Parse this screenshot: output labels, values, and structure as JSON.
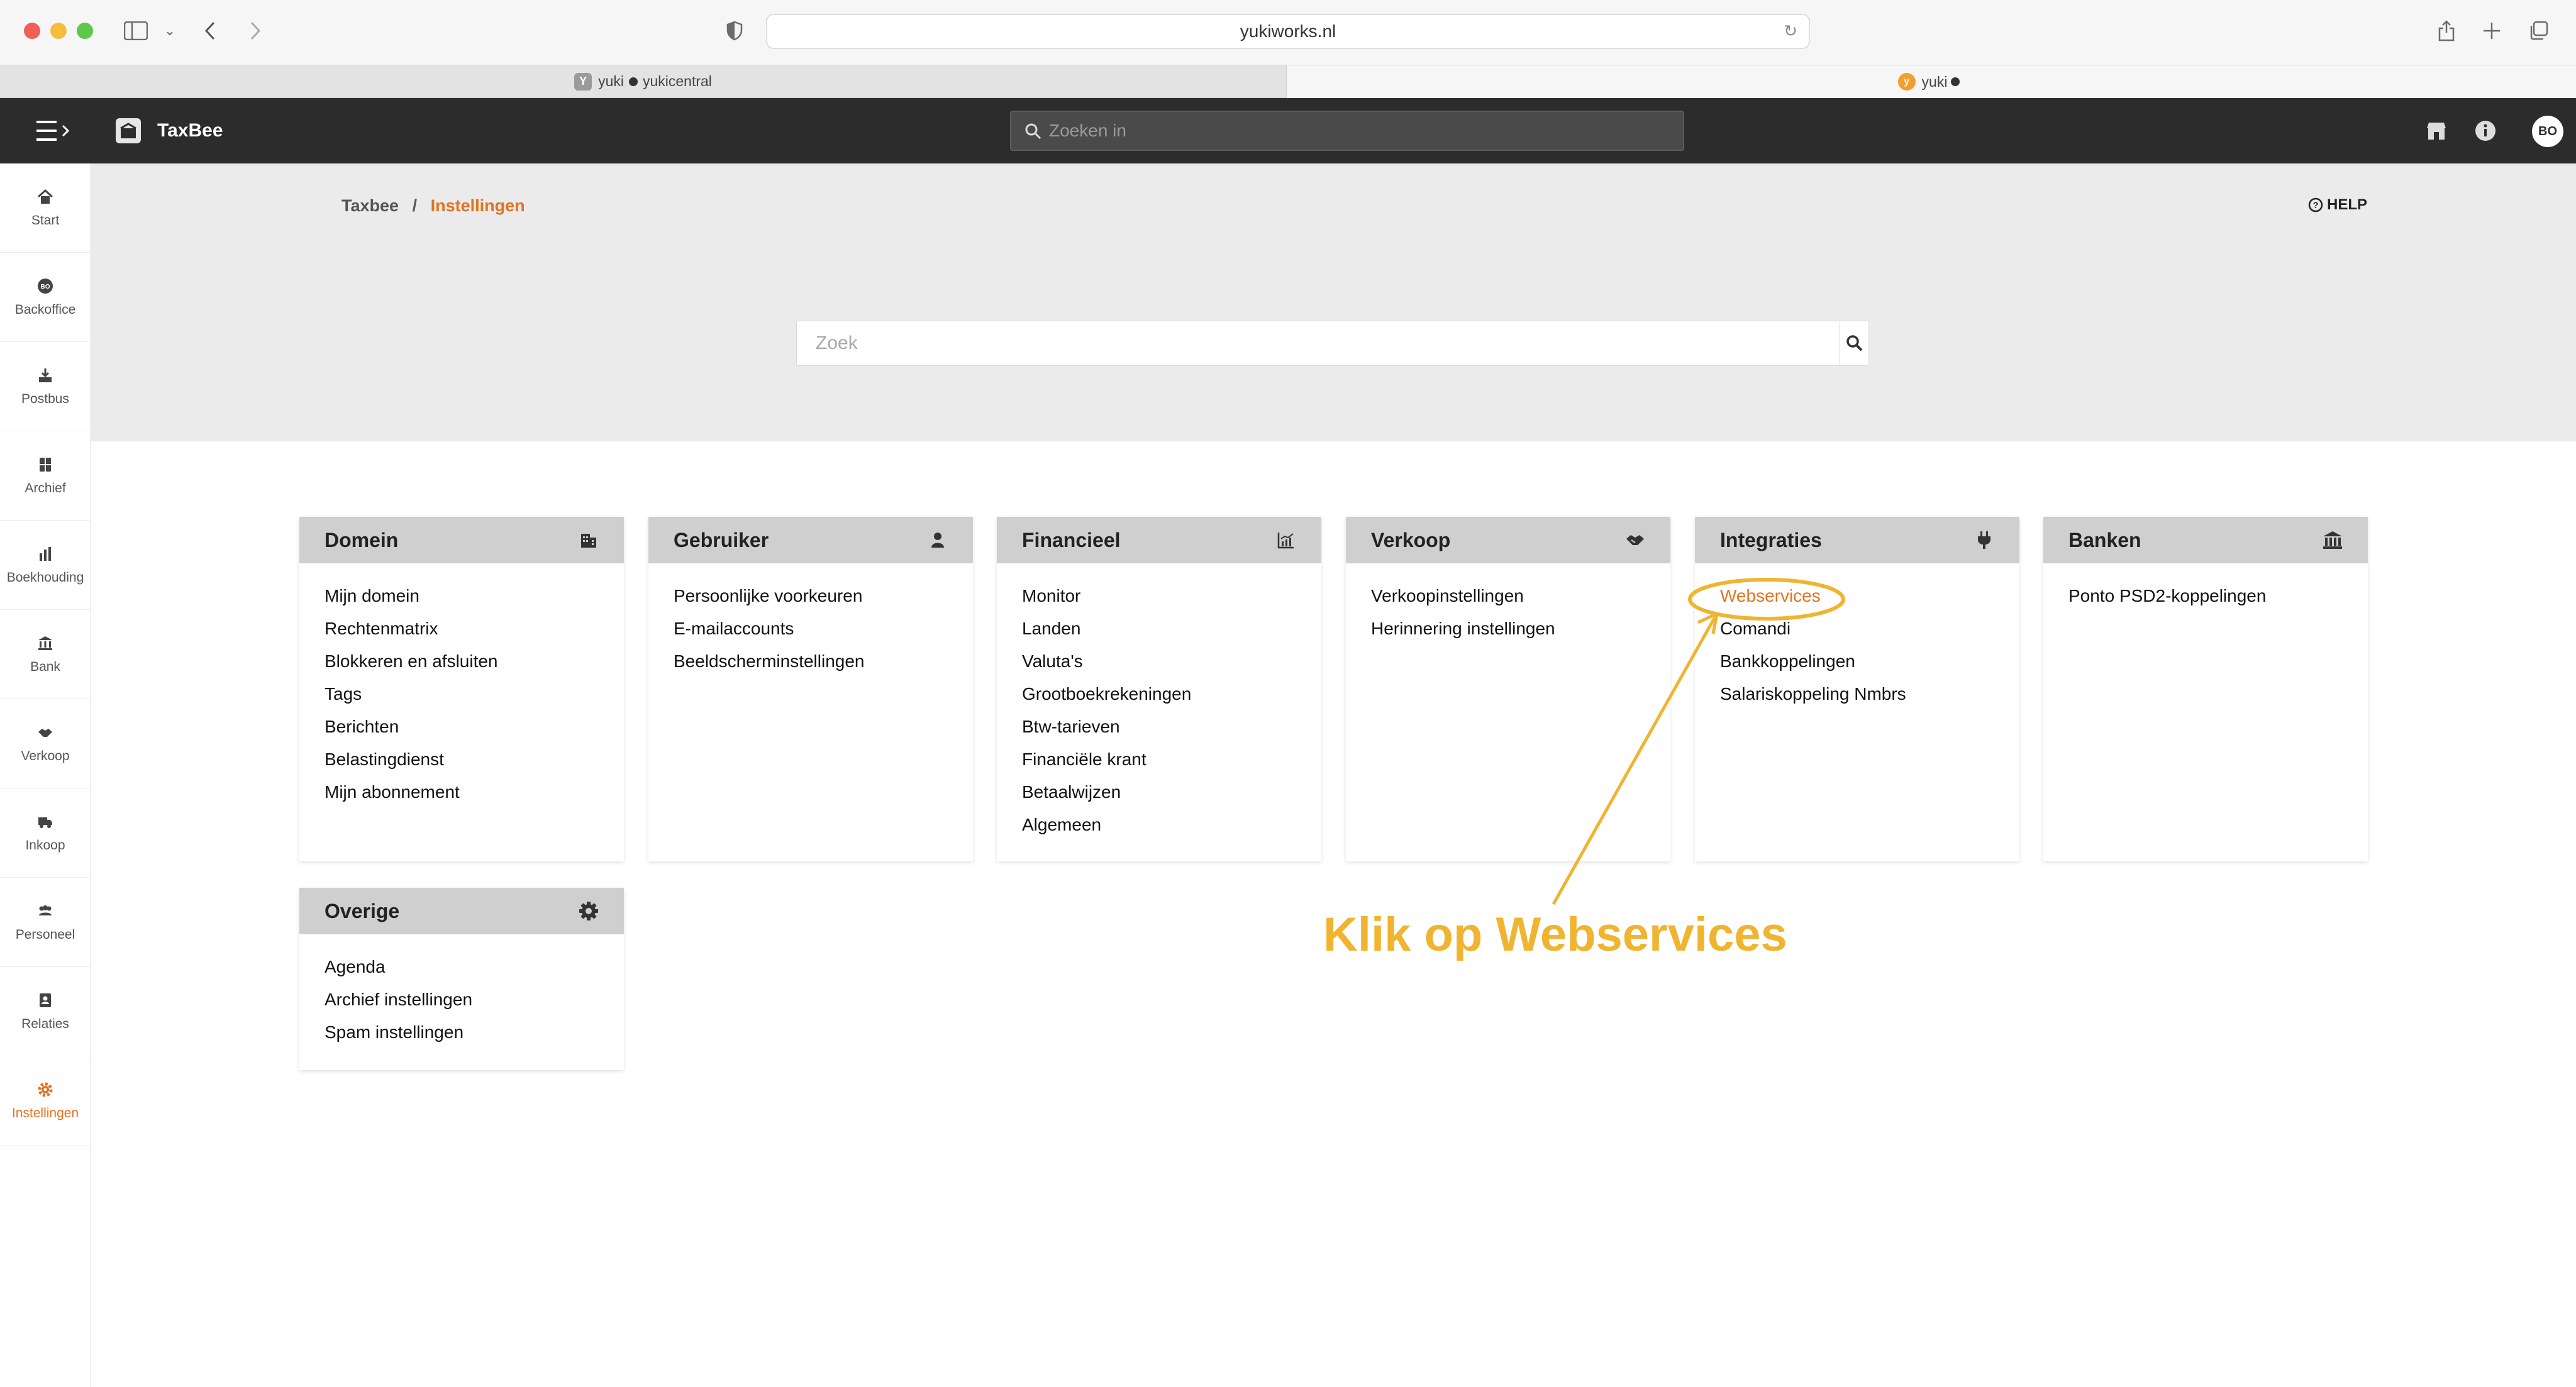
{
  "browser": {
    "url": "yukiworks.nl",
    "tabs": [
      {
        "label": "yuki",
        "sublabel": "yukicentral",
        "favicon": "Y"
      },
      {
        "label": "yuki",
        "favicon": "y"
      }
    ]
  },
  "app": {
    "brand": "TaxBee",
    "search_placeholder": "Zoeken in",
    "avatar_initials": "BO"
  },
  "sidebar": {
    "items": [
      {
        "label": "Start",
        "icon": "home-icon"
      },
      {
        "label": "Backoffice",
        "icon": "bo-icon"
      },
      {
        "label": "Postbus",
        "icon": "inbox-icon"
      },
      {
        "label": "Archief",
        "icon": "archive-icon"
      },
      {
        "label": "Boekhouding",
        "icon": "chart-icon"
      },
      {
        "label": "Bank",
        "icon": "bank-icon"
      },
      {
        "label": "Verkoop",
        "icon": "handshake-icon"
      },
      {
        "label": "Inkoop",
        "icon": "truck-icon"
      },
      {
        "label": "Personeel",
        "icon": "people-icon"
      },
      {
        "label": "Relaties",
        "icon": "contacts-icon"
      },
      {
        "label": "Instellingen",
        "icon": "gear-icon",
        "active": true
      }
    ]
  },
  "breadcrumb": {
    "root": "Taxbee",
    "separator": "/",
    "current": "Instellingen"
  },
  "help_label": "HELP",
  "search": {
    "placeholder": "Zoek"
  },
  "cards": {
    "domein": {
      "title": "Domein",
      "icon": "building-icon",
      "items": [
        "Mijn domein",
        "Rechtenmatrix",
        "Blokkeren en afsluiten",
        "Tags",
        "Berichten",
        "Belastingdienst",
        "Mijn abonnement"
      ]
    },
    "gebruiker": {
      "title": "Gebruiker",
      "icon": "user-icon",
      "items": [
        "Persoonlijke voorkeuren",
        "E-mailaccounts",
        "Beeldscherminstellingen"
      ]
    },
    "financieel": {
      "title": "Financieel",
      "icon": "chart-line-icon",
      "items": [
        "Monitor",
        "Landen",
        "Valuta's",
        "Grootboekrekeningen",
        "Btw-tarieven",
        "Financiële krant",
        "Betaalwijzen",
        "Algemeen"
      ]
    },
    "verkoop": {
      "title": "Verkoop",
      "icon": "handshake-icon",
      "items": [
        "Verkoopinstellingen",
        "Herinnering instellingen"
      ]
    },
    "integraties": {
      "title": "Integraties",
      "icon": "plug-icon",
      "items": [
        "Webservices",
        "Comandi",
        "Bankkoppelingen",
        "Salariskoppeling Nmbrs"
      ]
    },
    "banken": {
      "title": "Banken",
      "icon": "bank-icon",
      "items": [
        "Ponto PSD2-koppelingen"
      ]
    },
    "overige": {
      "title": "Overige",
      "icon": "gear-icon",
      "items": [
        "Agenda",
        "Archief instellingen",
        "Spam instellingen"
      ]
    }
  },
  "annotation": {
    "text": "Klik op Webservices",
    "color": "#f0b430"
  },
  "colors": {
    "accent": "#e2731f",
    "topbar": "#2c2c2c",
    "card_header": "#cfcfcf"
  }
}
